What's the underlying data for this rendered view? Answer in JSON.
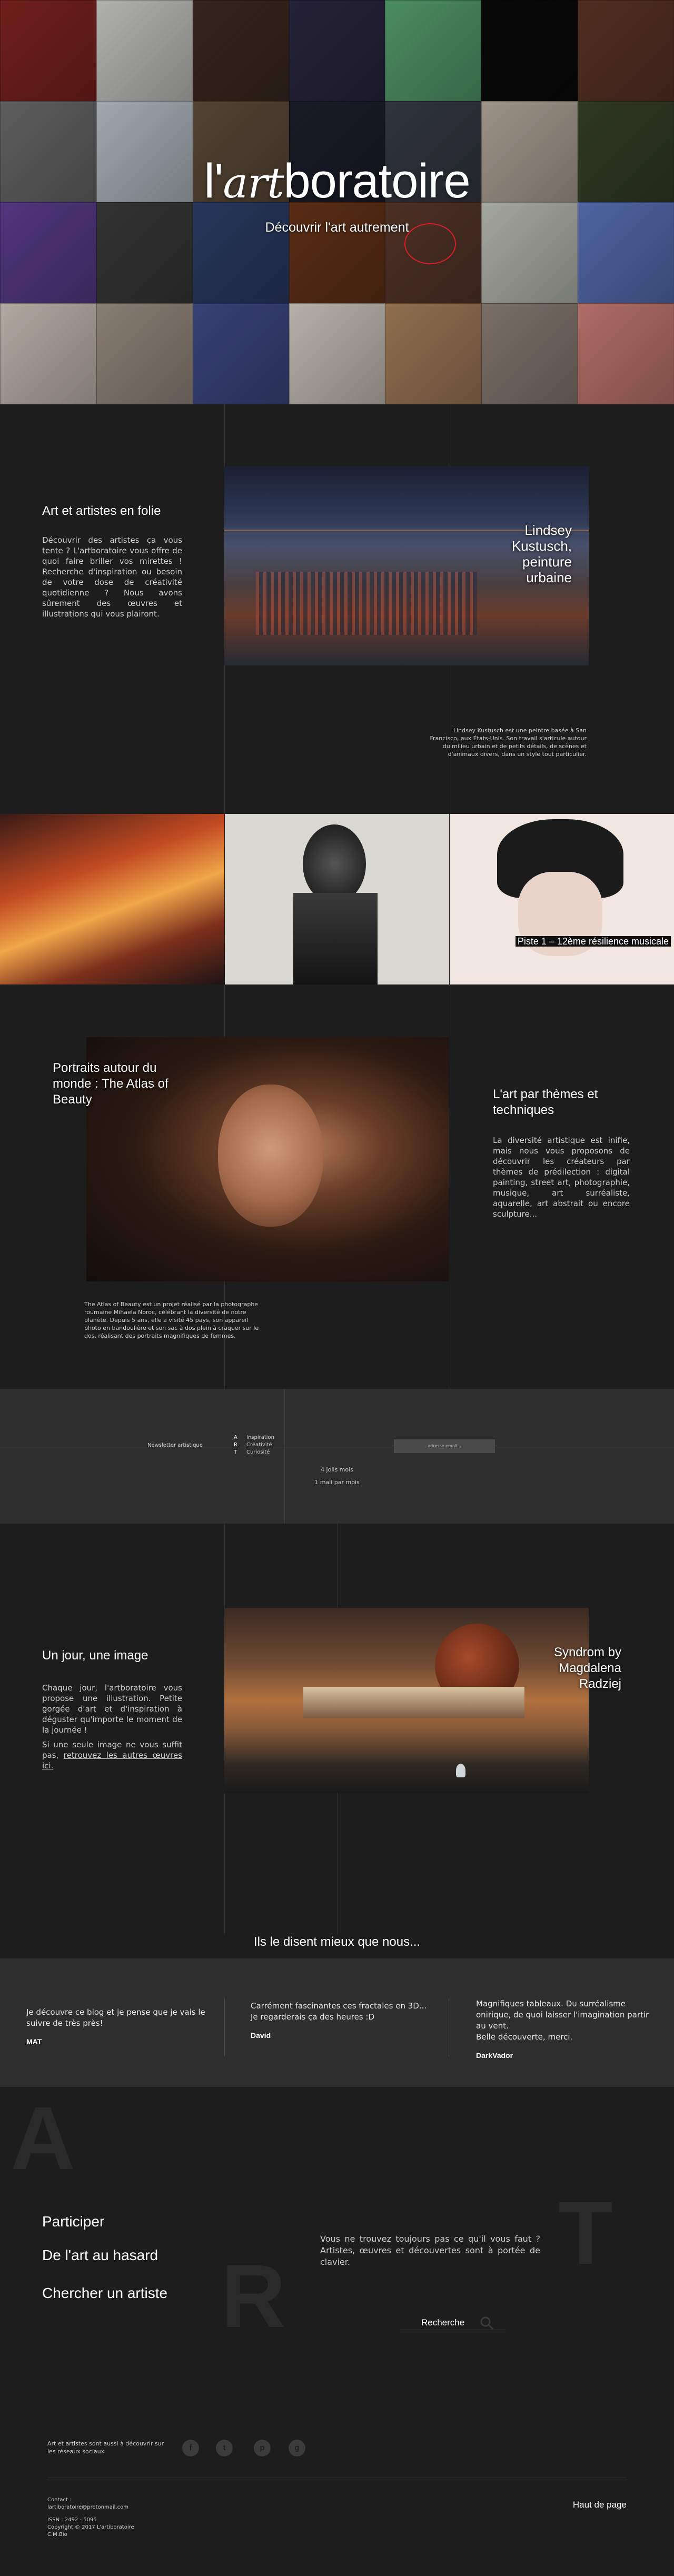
{
  "hero": {
    "logo": {
      "lead": "l'",
      "middle": "art",
      "tail": "boratoire"
    },
    "tagline": "Découvrir l'art autrement",
    "tiles": [
      "#7f2420",
      "#c9c9c6",
      "#3c2b21",
      "#2b2740",
      "#56a06f",
      "#0a0a0a",
      "#5c3527",
      "#6b6b6b",
      "#b7c0c7",
      "#5f4c3a",
      "#1f1f2d",
      "#373c44",
      "#b3a79a",
      "#364027",
      "#5c3e8e",
      "#3a3a3a",
      "#2c3e68",
      "#663318",
      "#57372a",
      "#bcbfb5",
      "#5a72b7",
      "#c9c0b6",
      "#9b8e82",
      "#3f4b86",
      "#cfc9bf",
      "#a47e5a",
      "#8b7f75",
      "#c77b73"
    ],
    "accent_circle": "#d71f2b"
  },
  "intro": {
    "heading": "Art et artistes en folie",
    "text": "Découvrir des artistes ça vous tente ? L'artboratoire vous offre de quoi faire briller vos mirettes ! Recherche d'inspiration ou besoin de votre dose de créativité quotidienne ? Nous avons sûrement des œuvres et illustrations qui vous plairont.",
    "feature_title": "Lindsey Kustusch, peinture urbaine",
    "feature_caption": "Lindsey Kustusch est une peintre basée à San Francisco, aux États-Unis. Son travail s'articule autour du milieu urbain et de petits détails, de scènes et d'animaux divers, dans un style tout particulier."
  },
  "strip": {
    "tag": "Piste 1 – 12ème résilience musicale"
  },
  "portraits": {
    "title": "Portraits autour du monde : The Atlas of Beauty",
    "caption": "The Atlas of Beauty est un projet réalisé par la photographe roumaine Mihaela Noroc, célébrant la diversité de notre planète. Depuis 5 ans, elle a visité 45 pays, son appareil photo en bandoulière et son sac à dos plein à craquer sur le dos, réalisant des portraits magnifiques de femmes.",
    "themes_heading": "L'art par thèmes et techniques",
    "themes_text": "La diversité artistique est inifie, mais nous vous proposons de découvrir les créateurs par thèmes de prédilection : digital painting, street art, photographie, musique, art surréaliste, aquarelle, art abstrait ou encore sculpture..."
  },
  "newsletter": {
    "label": "Newsletter artistique",
    "acrostic": [
      {
        "letter": "A",
        "word": "Inspiration"
      },
      {
        "letter": "R",
        "word": "Créativité"
      },
      {
        "letter": "T",
        "word": "Curiosité"
      }
    ],
    "freq1": "4 jolis mois",
    "freq2": "1 mail par mois",
    "input_placeholder": "adresse email..."
  },
  "daily": {
    "heading": "Un jour, une image",
    "text1": "Chaque jour, l'artboratoire vous propose une illustration. Petite gorgée d'art et d'inspiration à déguster qu'importe le moment de la journée !",
    "text2": "Si une seule image ne vous suffit pas, ",
    "link": "retrouvez les autres œuvres ici.",
    "feature_title": "Syndrom by Magdalena Radziej"
  },
  "testimonials": {
    "heading": "Ils le disent mieux que nous...",
    "items": [
      {
        "quote": "Je découvre ce blog et je pense que je vais le suivre de très près!",
        "author": "MAT"
      },
      {
        "quote": "Carrément fascinantes ces fractales en 3D...\nJe regarderais ça des heures :D",
        "author": "David"
      },
      {
        "quote": "Magnifiques tableaux. Du surréalisme onirique, de quoi laisser l'imagination partir au vent.\nBelle découverte, merci.",
        "author": "DarkVador"
      }
    ]
  },
  "footer": {
    "links": [
      "Participer",
      "De l'art au hasard",
      "Chercher un artiste"
    ],
    "text": "Vous ne trouvez toujours pas ce qu'il vous faut ? Artistes, œuvres et découvertes sont à portée de clavier.",
    "search_label": "Recherche",
    "letters": [
      "A",
      "R",
      "T"
    ],
    "social_text": "Art et artistes sont aussi à découvrir sur les réseaux sociaux",
    "socials": [
      "f",
      "t",
      "p",
      "g"
    ],
    "contact_label": "Contact :",
    "email": "lartiboratoire@protonmail.com",
    "issn": "ISSN : 2492 - 5095",
    "copyright": "Copyright © 2017 L'artiboratoire",
    "legal": "C.M.Bio",
    "back_to_top": "Haut de page"
  }
}
